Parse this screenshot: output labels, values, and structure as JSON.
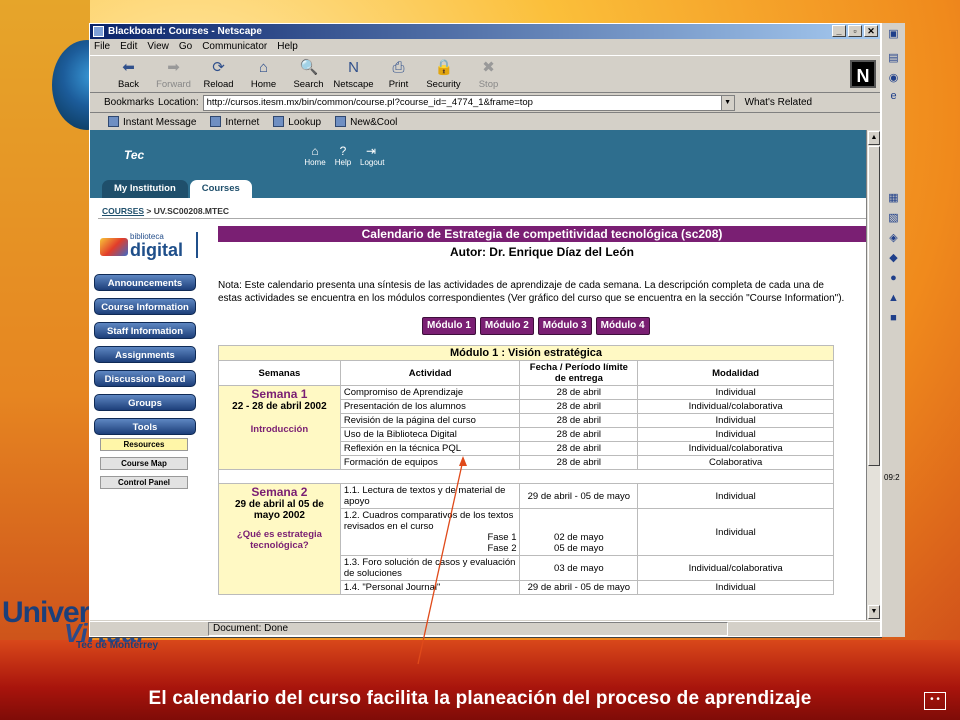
{
  "caption": "El calendario del curso facilita la planeación del proceso de aprendizaje",
  "branding": {
    "univer": "Univer",
    "virtual": "Virtual",
    "tec": "Tec de Monterrey"
  },
  "browser": {
    "title": "Blackboard: Courses - Netscape",
    "menu": [
      "File",
      "Edit",
      "View",
      "Go",
      "Communicator",
      "Help"
    ],
    "toolbar": [
      {
        "label": "Back",
        "icon": "back-arrow-icon",
        "glyph": "⬅"
      },
      {
        "label": "Forward",
        "icon": "forward-arrow-icon",
        "glyph": "➡",
        "disabled": true
      },
      {
        "label": "Reload",
        "icon": "reload-icon",
        "glyph": "⟳"
      },
      {
        "label": "Home",
        "icon": "home-icon",
        "glyph": "⌂"
      },
      {
        "label": "Search",
        "icon": "search-icon",
        "glyph": "🔍"
      },
      {
        "label": "Netscape",
        "icon": "netscape-icon",
        "glyph": "N"
      },
      {
        "label": "Print",
        "icon": "print-icon",
        "glyph": "⎙"
      },
      {
        "label": "Security",
        "icon": "lock-icon",
        "glyph": "🔒"
      },
      {
        "label": "Stop",
        "icon": "stop-icon",
        "glyph": "✖",
        "disabled": true
      }
    ],
    "bookmarks_label": "Bookmarks",
    "location_label": "Location:",
    "url": "http://cursos.itesm.mx/bin/common/course.pl?course_id=_4774_1&frame=top",
    "whats_related": "What's Related",
    "personal_bar": [
      "Instant Message",
      "Internet",
      "Lookup",
      "New&Cool"
    ],
    "status": "Document: Done"
  },
  "blackboard": {
    "logo_text": "Tec",
    "header_icons": [
      "Home",
      "Help",
      "Logout"
    ],
    "tabs": [
      "My Institution",
      "Courses"
    ],
    "breadcrumb_link": "COURSES",
    "breadcrumb_rest": " > UV.SC00208.MTEC",
    "biblio_small": "biblioteca",
    "biblio_big": "digital",
    "menu": [
      "Announcements",
      "Course Information",
      "Staff Information",
      "Assignments",
      "Discussion Board",
      "Groups",
      "Tools"
    ],
    "submenu": [
      "Resources",
      "Course Map",
      "Control Panel"
    ]
  },
  "calendar": {
    "title": "Calendario de Estrategia de competitividad tecnológica (sc208)",
    "author": "Autor: Dr. Enrique Díaz del León",
    "nota": "Nota: Este calendario presenta una síntesis de las actividades de aprendizaje de cada semana. La descripción completa de cada una de estas actividades se encuentra en los módulos correspondientes (Ver gráfico del curso que se encuentra en la sección \"Course Information\").",
    "modules": [
      "Módulo 1",
      "Módulo 2",
      "Módulo 3",
      "Módulo 4"
    ],
    "module_heading": "Módulo 1 : Visión estratégica",
    "columns": [
      "Semanas",
      "Actividad",
      "Fecha / Período límite de entrega",
      "Modalidad"
    ],
    "week1": {
      "name": "Semana 1",
      "dates": "22 - 28 de abril 2002",
      "topic": "Introducción",
      "rows": [
        {
          "act": "Compromiso de Aprendizaje",
          "date": "28 de abril",
          "mod": "Individual"
        },
        {
          "act": "Presentación de los alumnos",
          "date": "28 de abril",
          "mod": "Individual/colaborativa"
        },
        {
          "act": "Revisión de la página del curso",
          "date": "28 de abril",
          "mod": "Individual"
        },
        {
          "act": "Uso de la Biblioteca Digital",
          "date": "28 de abril",
          "mod": "Individual"
        },
        {
          "act": "Reflexión en la técnica PQL",
          "date": "28 de abril",
          "mod": "Individual/colaborativa"
        },
        {
          "act": "Formación de equipos",
          "date": "28 de abril",
          "mod": "Colaborativa"
        }
      ]
    },
    "week2": {
      "name": "Semana 2",
      "dates": "29 de abril al 05 de mayo 2002",
      "topic": "¿Qué es estrategia tecnológica?",
      "row1": {
        "act": "1.1. Lectura de textos y de material de apoyo",
        "date": "29 de abril - 05 de mayo",
        "mod": "Individual"
      },
      "row2": {
        "act": "1.2. Cuadros comparativos de los textos revisados en el curso",
        "fase1": "Fase 1",
        "fase2": "Fase 2",
        "date1": "02 de mayo",
        "date2": "05 de mayo",
        "mod": "Individual"
      },
      "row3": {
        "act": "1.3. Foro solución de casos y evaluación de soluciones",
        "date": "03 de mayo",
        "mod": "Individual/colaborativa"
      },
      "row4": {
        "act": "1.4. \"Personal Journal\"",
        "date": "29 de abril - 05 de mayo",
        "mod": "Individual"
      }
    }
  },
  "taskbar_clock": "09:2",
  "colors": {
    "accent_purple": "#7a1f73",
    "bb_header": "#2e6e8e",
    "week_bg": "#fff9c4"
  }
}
